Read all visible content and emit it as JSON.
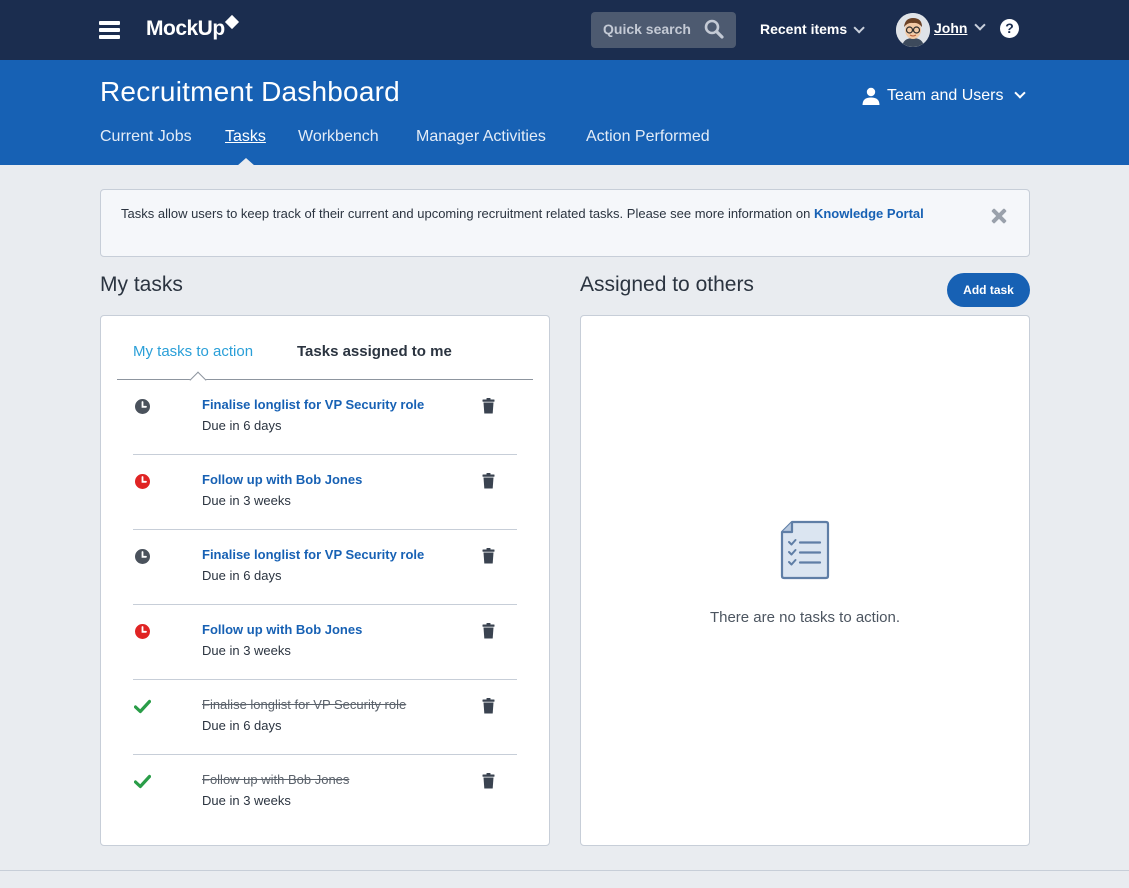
{
  "topbar": {
    "logo": "MockUp",
    "quick_search_placeholder": "Quick search",
    "recent_items": "Recent items",
    "user_name": "John",
    "help": "?"
  },
  "header": {
    "title": "Recruitment Dashboard",
    "team_menu": "Team and Users",
    "nav": [
      "Current Jobs",
      "Tasks",
      "Workbench",
      "Manager Activities",
      "Action Performed"
    ],
    "active_nav": "Tasks"
  },
  "banner": {
    "text": "Tasks allow users to keep track of their current and upcoming recruitment related tasks. Please see more information on",
    "link": "Knowledge Portal"
  },
  "my_tasks": {
    "title": "My tasks",
    "tabs": [
      "My tasks to action",
      "Tasks assigned to me"
    ],
    "active_tab": "My tasks to action",
    "items": [
      {
        "title": "Finalise longlist for VP Security role",
        "due": "Due in 6 days",
        "status": "pending"
      },
      {
        "title": "Follow up with Bob Jones",
        "due": "Due in 3 weeks",
        "status": "overdue"
      },
      {
        "title": "Finalise longlist for VP Security role",
        "due": "Due in 6 days",
        "status": "pending"
      },
      {
        "title": "Follow up with Bob Jones",
        "due": "Due in 3 weeks",
        "status": "overdue"
      },
      {
        "title": "Finalise longlist for VP Security role",
        "due": "Due in 6 days",
        "status": "done"
      },
      {
        "title": "Follow up with Bob Jones",
        "due": "Due in 3 weeks",
        "status": "done"
      }
    ]
  },
  "assigned": {
    "title": "Assigned to others",
    "add_button": "Add task",
    "empty_text": "There are no tasks to action."
  },
  "colors": {
    "topbar": "#1b2d4f",
    "header": "#1761b4",
    "pending": "#4a525c",
    "overdue": "#e02424",
    "done": "#2a9d48",
    "active_tab": "#2a9fd8"
  },
  "icons": {
    "menu": "hamburger-icon",
    "search": "search-icon",
    "user": "user-icon",
    "close": "close-icon",
    "pending": "clock-icon",
    "overdue": "overdue-clock-icon",
    "done": "checkmark-icon",
    "delete": "trash-icon",
    "empty": "checklist-document-icon"
  }
}
